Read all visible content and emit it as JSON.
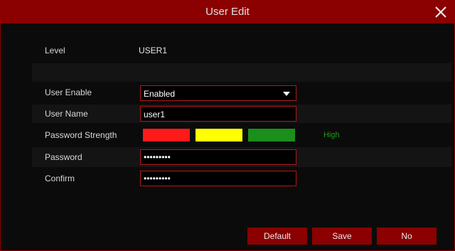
{
  "dialog": {
    "title": "User Edit"
  },
  "icons": {
    "close": "close-icon",
    "dropdown": "chevron-down-icon"
  },
  "colors": {
    "title_bar": "#8b0000",
    "field_border": "#b01818",
    "strength_low": "#ff1a1a",
    "strength_mid": "#ffff00",
    "strength_high": "#1b8f1b",
    "strength_text": "#1e9a1e"
  },
  "form": {
    "level": {
      "label": "Level",
      "value": "USER1"
    },
    "user_enable": {
      "label": "User Enable",
      "value": "Enabled"
    },
    "user_name": {
      "label": "User Name",
      "value": "user1"
    },
    "password_strength": {
      "label": "Password Strength",
      "value": "High"
    },
    "password": {
      "label": "Password",
      "value": "•••••••••"
    },
    "confirm": {
      "label": "Confirm",
      "value": "•••••••••"
    }
  },
  "buttons": {
    "default": "Default",
    "save": "Save",
    "no": "No"
  }
}
